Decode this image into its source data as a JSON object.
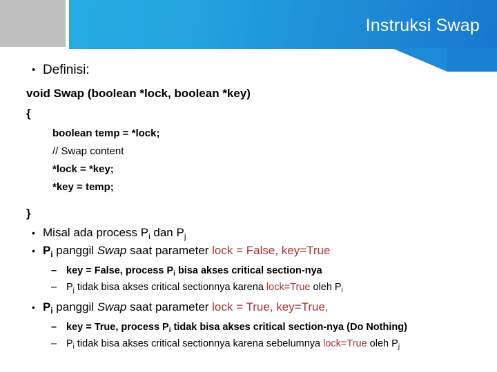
{
  "slide": {
    "title": "Instruksi Swap",
    "theme": {
      "banner_light": "#26abe4",
      "banner_dark": "#1877cf",
      "banner_gray": "#bfbfbf",
      "accent_red": "#a83434",
      "text": "#000000",
      "title_text": "#ffffff",
      "background": "#ffffff"
    },
    "bullet_glyph": "•",
    "dash_glyph": "–"
  },
  "content": {
    "definisi_label": "Definisi:",
    "signature": "void Swap (boolean *lock, boolean *key)",
    "brace_open": "{",
    "brace_close": "}",
    "code_lines": [
      {
        "text": "boolean temp = *lock;",
        "bold": true
      },
      {
        "text": "// Swap content",
        "bold": false
      },
      {
        "text": "*lock = *key;",
        "bold": true
      },
      {
        "text": "*key = temp;",
        "bold": true
      }
    ],
    "bullet_misal": {
      "part1": "Misal ada process P",
      "sub1": "i",
      "part2": " dan P",
      "sub2": "j"
    },
    "case_false": {
      "p_label": "P",
      "p_sub": "i",
      "panggil": " panggil ",
      "swap": "Swap",
      "saat": " saat parameter ",
      "params": "lock = False, key=True"
    },
    "case_false_sub1": {
      "pre": "key = False, process P",
      "sub": "i",
      "post": "  bisa akses critical section-nya"
    },
    "case_false_sub2": {
      "p": "P",
      "p_sub": "j",
      "mid": " tidak bisa akses critical sectionnya karena ",
      "red": "lock=True",
      "tail": " oleh P",
      "tail_sub": "i"
    },
    "case_true": {
      "p_label": "P",
      "p_sub": "i",
      "panggil": " panggil ",
      "swap": "Swap",
      "saat": " saat parameter ",
      "params": "lock = True, key=True,"
    },
    "case_true_sub1": {
      "pre": "key = True, process P",
      "sub": "i",
      "post": " tidak bisa akses critical section-nya (Do Nothing)"
    },
    "case_true_sub2": {
      "p": "P",
      "p_sub": "i",
      "mid": " tidak bisa akses critical sectionnya karena sebelumnya ",
      "red": "lock=True",
      "tail": " oleh P",
      "tail_sub": "j"
    }
  }
}
